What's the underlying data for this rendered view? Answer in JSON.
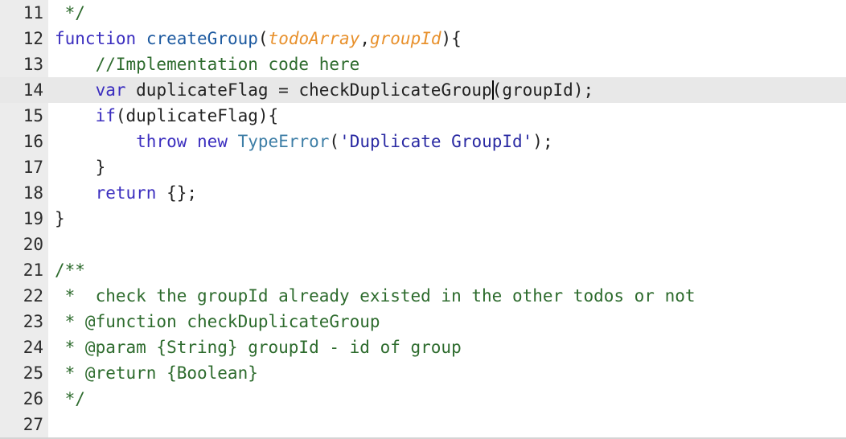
{
  "editor": {
    "lines": [
      {
        "num": "11",
        "highlighted": false,
        "tokens": [
          {
            "t": " */",
            "k": "cm"
          }
        ]
      },
      {
        "num": "12",
        "highlighted": false,
        "tokens": [
          {
            "t": "function",
            "k": "kw"
          },
          {
            "t": " ",
            "k": ""
          },
          {
            "t": "createGroup",
            "k": "fn"
          },
          {
            "t": "(",
            "k": ""
          },
          {
            "t": "todoArray",
            "k": "param"
          },
          {
            "t": ",",
            "k": ""
          },
          {
            "t": "groupId",
            "k": "param"
          },
          {
            "t": "){",
            "k": ""
          }
        ]
      },
      {
        "num": "13",
        "highlighted": false,
        "tokens": [
          {
            "t": "    //Implementation code here",
            "k": "cm"
          }
        ]
      },
      {
        "num": "14",
        "highlighted": true,
        "caret": true,
        "tokens": [
          {
            "t": "    ",
            "k": ""
          },
          {
            "t": "var",
            "k": "kw"
          },
          {
            "t": " duplicateFlag = checkDuplicateGroup",
            "k": ""
          },
          {
            "t": "",
            "k": "caret"
          },
          {
            "t": "(groupId);",
            "k": ""
          }
        ]
      },
      {
        "num": "15",
        "highlighted": false,
        "tokens": [
          {
            "t": "    ",
            "k": ""
          },
          {
            "t": "if",
            "k": "kw"
          },
          {
            "t": "(duplicateFlag){",
            "k": ""
          }
        ]
      },
      {
        "num": "16",
        "highlighted": false,
        "tokens": [
          {
            "t": "        ",
            "k": ""
          },
          {
            "t": "throw",
            "k": "kw"
          },
          {
            "t": " ",
            "k": ""
          },
          {
            "t": "new",
            "k": "kw"
          },
          {
            "t": " ",
            "k": ""
          },
          {
            "t": "TypeError",
            "k": "cls"
          },
          {
            "t": "(",
            "k": ""
          },
          {
            "t": "'Duplicate GroupId'",
            "k": "str"
          },
          {
            "t": ");",
            "k": ""
          }
        ]
      },
      {
        "num": "17",
        "highlighted": false,
        "tokens": [
          {
            "t": "    }",
            "k": ""
          }
        ]
      },
      {
        "num": "18",
        "highlighted": false,
        "tokens": [
          {
            "t": "    ",
            "k": ""
          },
          {
            "t": "return",
            "k": "kw"
          },
          {
            "t": " {};",
            "k": ""
          }
        ]
      },
      {
        "num": "19",
        "highlighted": false,
        "tokens": [
          {
            "t": "}",
            "k": ""
          }
        ]
      },
      {
        "num": "20",
        "highlighted": false,
        "tokens": []
      },
      {
        "num": "21",
        "highlighted": false,
        "tokens": [
          {
            "t": "/**",
            "k": "cm"
          }
        ]
      },
      {
        "num": "22",
        "highlighted": false,
        "tokens": [
          {
            "t": " *  check the groupId already existed in the other todos or not",
            "k": "cm"
          }
        ]
      },
      {
        "num": "23",
        "highlighted": false,
        "tokens": [
          {
            "t": " * @function checkDuplicateGroup",
            "k": "cm"
          }
        ]
      },
      {
        "num": "24",
        "highlighted": false,
        "tokens": [
          {
            "t": " * @param {String} groupId - id of group",
            "k": "cm"
          }
        ]
      },
      {
        "num": "25",
        "highlighted": false,
        "tokens": [
          {
            "t": " * @return {Boolean}",
            "k": "cm"
          }
        ]
      },
      {
        "num": "26",
        "highlighted": false,
        "tokens": [
          {
            "t": " */",
            "k": "cm"
          }
        ]
      },
      {
        "num": "27",
        "highlighted": false,
        "tokens": []
      }
    ]
  }
}
